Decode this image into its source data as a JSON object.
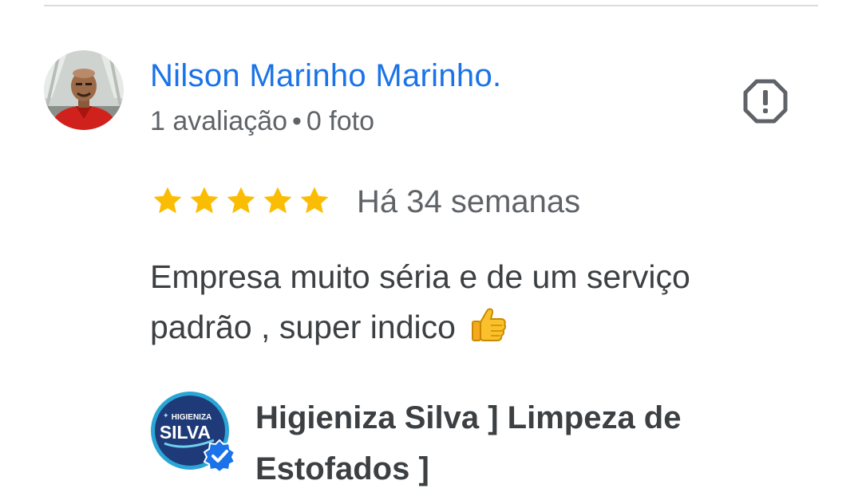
{
  "reviewer": {
    "name": "Nilson Marinho Marinho.",
    "meta_reviews": "1 avaliação",
    "meta_separator": "•",
    "meta_photos": "0 foto",
    "avatar_icon": "user-avatar-photo"
  },
  "review": {
    "rating": 5,
    "rating_max": 5,
    "date": "Há 34 semanas",
    "text": "Empresa muito séria e de um serviço padrão , super indico",
    "emoji": "thumbs-up-emoji"
  },
  "actions": {
    "report_icon": "report-icon"
  },
  "business": {
    "logo_line1": "HIGIENIZA",
    "logo_line2": "SILVA",
    "verified_icon": "verified-badge-icon",
    "name": "Higieniza Silva ] Limpeza de Estofados ]"
  },
  "colors": {
    "name_link": "#1a73e8",
    "meta_text": "#5f6368",
    "star": "#fbbc04",
    "body_text": "#3c4043",
    "divider": "#dadce0",
    "logo_ring": "#2aa6d6",
    "logo_bg": "#1f3a78",
    "verified": "#1a73e8"
  }
}
